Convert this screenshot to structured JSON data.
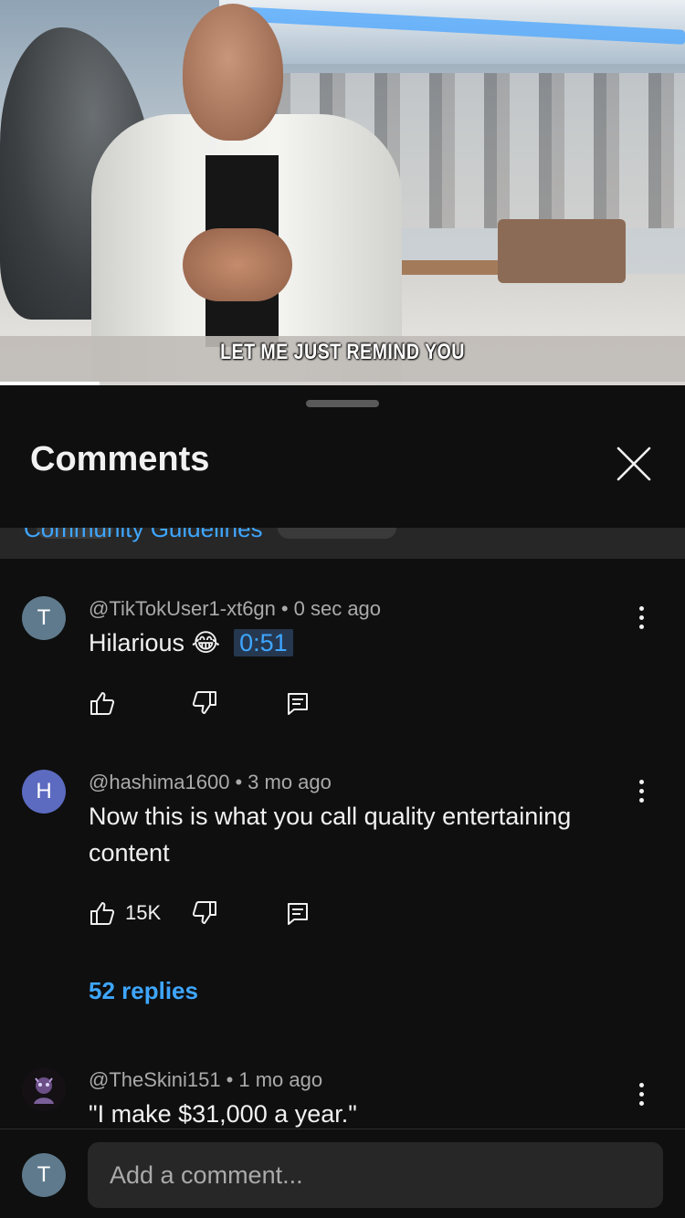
{
  "video": {
    "caption": "LET ME JUST REMIND YOU",
    "progress_fraction": 0.145
  },
  "sheet": {
    "title": "Comments",
    "guidelines_text": "Community Guidelines"
  },
  "comments": [
    {
      "avatar_letter": "T",
      "avatar_color": "#5f7a8c",
      "author": "@TikTokUser1-xt6gn",
      "time": "0 sec ago",
      "text": "Hilarious 😂",
      "timestamp": "0:51",
      "likes": ""
    },
    {
      "avatar_letter": "H",
      "avatar_color": "#5c6bc0",
      "author": "@hashima1600",
      "time": "3 mo ago",
      "text": "Now this is what you call quality entertaining content",
      "likes": "15K",
      "replies": "52 replies"
    },
    {
      "avatar_letter": "",
      "avatar_color": "#1a1a1a",
      "author": "@TheSkini151",
      "time": "1 mo ago",
      "text": "\"I make $31,000 a year.\""
    }
  ],
  "composer": {
    "avatar_letter": "T",
    "avatar_color": "#5f7a8c",
    "placeholder": "Add a comment..."
  },
  "colors": {
    "background": "#0f0f0f",
    "link": "#3ea6ff",
    "secondary_text": "#aaaaaa"
  }
}
